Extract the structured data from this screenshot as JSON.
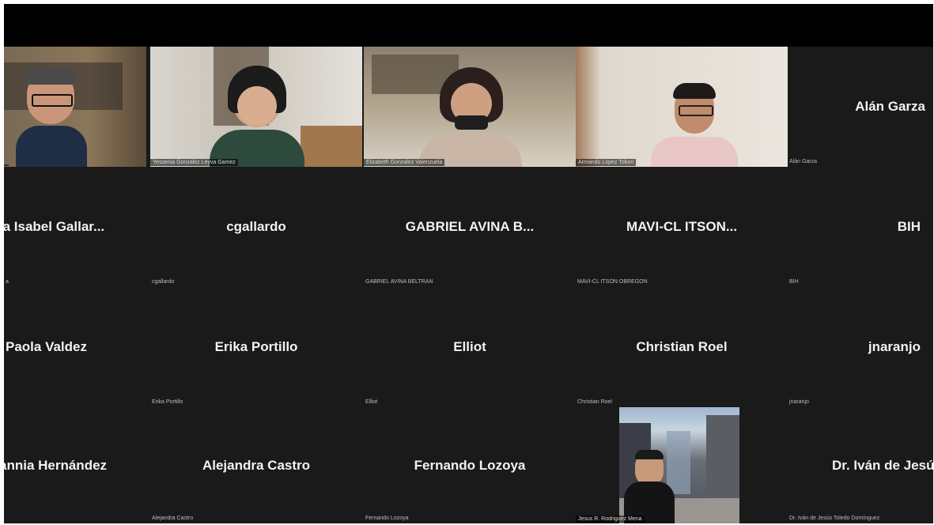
{
  "meeting": {
    "video_tiles": [
      {
        "name": "",
        "subtitle": ""
      },
      {
        "name": "",
        "subtitle": "Yessenia Gonzalez Leyva Gamez"
      },
      {
        "name": "",
        "subtitle": "Elizabeth Gonzalez Valenzuela"
      },
      {
        "name": "",
        "subtitle": "Armando Lopez Tobon"
      },
      {
        "name": "",
        "subtitle": "Jesus R. Rodriguez Mena"
      }
    ],
    "rows": [
      [
        {
          "big": "",
          "small": ""
        },
        {
          "big": "",
          "small": ""
        },
        {
          "big": "",
          "small": ""
        },
        {
          "big": "",
          "small": ""
        },
        {
          "big": "Alán Garza",
          "small": "Alán Garza"
        }
      ],
      [
        {
          "big": "ra Isabel Gallar...",
          "small": "a"
        },
        {
          "big": "cgallardo",
          "small": "cgallardo"
        },
        {
          "big": "GABRIEL AVINA B...",
          "small": "GABRIEL AVINA BELTRAN"
        },
        {
          "big": "MAVI-CL ITSON...",
          "small": "MAVI-CL ITSON OBREGON"
        },
        {
          "big": "BIH",
          "small": "BIH"
        }
      ],
      [
        {
          "big": "Paola Valdez",
          "small": ""
        },
        {
          "big": "Erika Portillo",
          "small": "Erika Portillo"
        },
        {
          "big": "Elliot",
          "small": "Elliot"
        },
        {
          "big": "Christian Roel",
          "small": "Christian Roel"
        },
        {
          "big": "jnaranjo",
          "small": "jnaranjo"
        }
      ],
      [
        {
          "big": "annia Hernández",
          "small": ""
        },
        {
          "big": "Alejandra Castro",
          "small": "Alejandra Castro"
        },
        {
          "big": "Fernando Lozoya",
          "small": "Fernando Lozoya"
        },
        {
          "big": "",
          "small": ""
        },
        {
          "big": "Dr. Iván de Jesú",
          "small": "Dr. Iván de Jesús Toledo Domínguez"
        }
      ]
    ]
  }
}
